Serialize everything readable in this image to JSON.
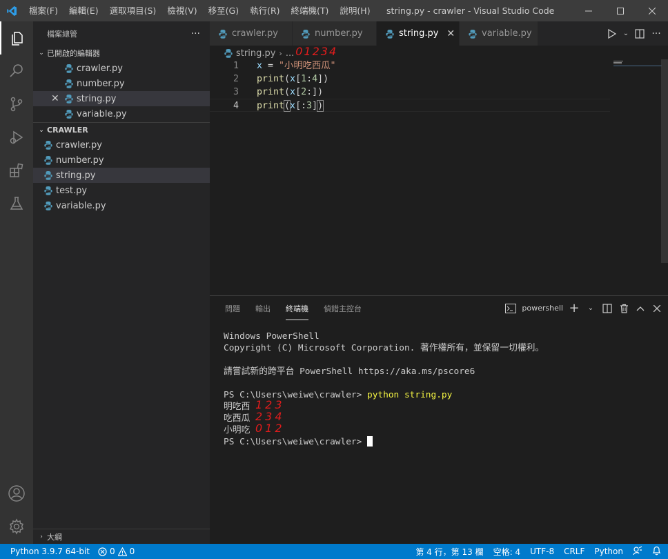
{
  "window": {
    "title": "string.py - crawler - Visual Studio Code",
    "menu": [
      "檔案(F)",
      "編輯(E)",
      "選取項目(S)",
      "檢視(V)",
      "移至(G)",
      "執行(R)",
      "終端機(T)",
      "說明(H)"
    ]
  },
  "sidebar": {
    "header": "檔案總管",
    "more": "···",
    "open_editors_title": "已開啟的編輯器",
    "open_editors": [
      "crawler.py",
      "number.py",
      "string.py",
      "variable.py"
    ],
    "folder_title": "CRAWLER",
    "files": [
      "crawler.py",
      "number.py",
      "string.py",
      "test.py",
      "variable.py"
    ],
    "selected_file": "string.py",
    "outline_title": "大綱"
  },
  "tabs": [
    "crawler.py",
    "number.py",
    "string.py",
    "variable.py"
  ],
  "active_tab": "string.py",
  "breadcrumb": {
    "file": "string.py",
    "rest": "...",
    "annotation": "01234"
  },
  "code": {
    "line_numbers": [
      "1",
      "2",
      "3",
      "4"
    ],
    "line1": {
      "var": "x",
      "op": " = ",
      "str": "\"小明吃西瓜\""
    },
    "line2": {
      "fn": "print",
      "open": "(",
      "var": "x",
      "idx_open": "[",
      "a": "1",
      "colon": ":",
      "b": "4",
      "idx_close": "]",
      "close": ")"
    },
    "line3": {
      "fn": "print",
      "open": "(",
      "var": "x",
      "idx_open": "[",
      "a": "2",
      "colon": ":",
      "idx_close": "]",
      "close": ")"
    },
    "line4": {
      "fn": "print",
      "open": "(",
      "var": "x",
      "idx_open": "[",
      "colon": ":",
      "b": "3",
      "idx_close": "]",
      "close": ")"
    }
  },
  "panel": {
    "tabs": [
      "問題",
      "輸出",
      "終端機",
      "偵錯主控台"
    ],
    "active_tab": "終端機",
    "shell": "powershell",
    "terminal": {
      "line1": "Windows PowerShell",
      "line2": "Copyright (C) Microsoft Corporation. 著作權所有，並保留一切權利。",
      "line3": "請嘗試新的跨平台 PowerShell https://aka.ms/pscore6",
      "prompt": "PS C:\\Users\\weiwe\\crawler> ",
      "command": "python string.py",
      "out1": "明吃西",
      "out2": "吃西瓜",
      "out3": "小明吃",
      "ann1": "123",
      "ann2": "234",
      "ann3": "012"
    }
  },
  "statusbar": {
    "python": "Python 3.9.7 64-bit",
    "errors": "0",
    "warnings": "0",
    "position": "第 4 行，第 13 欄",
    "spaces": "空格: 4",
    "encoding": "UTF-8",
    "eol": "CRLF",
    "language": "Python"
  },
  "colors": {
    "accent": "#007acc",
    "python_icon": "#519aba",
    "annotation": "#e21c1c"
  }
}
